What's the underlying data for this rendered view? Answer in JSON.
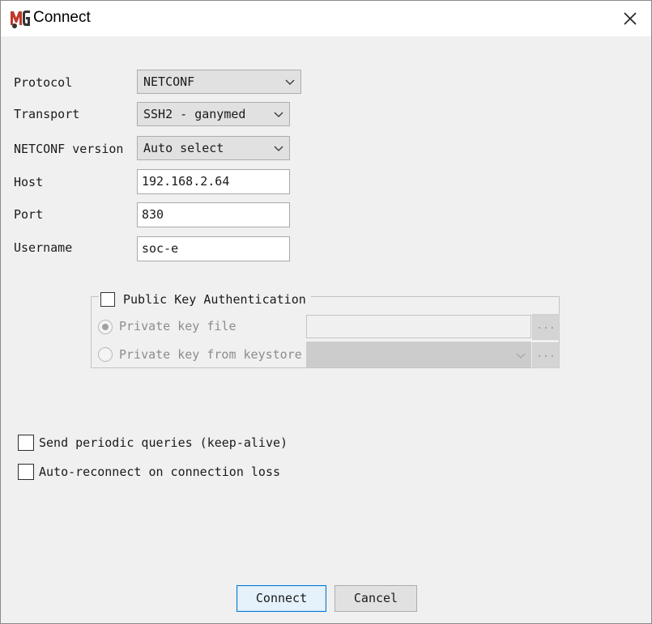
{
  "window": {
    "title": "Connect"
  },
  "form": {
    "protocol": {
      "label": "Protocol",
      "value": "NETCONF"
    },
    "transport": {
      "label": "Transport",
      "value": "SSH2 - ganymed"
    },
    "netconf_version": {
      "label": "NETCONF version",
      "value": "Auto select"
    },
    "host": {
      "label": "Host",
      "value": "192.168.2.64"
    },
    "port": {
      "label": "Port",
      "value": "830"
    },
    "username": {
      "label": "Username",
      "value": "soc-e"
    }
  },
  "pubkey": {
    "label": "Public Key Authentication",
    "checked": false,
    "private_key_file_label": "Private key file",
    "private_key_keystore_label": "Private key from keystore",
    "browse_label": "..."
  },
  "options": {
    "keepalive_label": "Send periodic queries (keep-alive)",
    "reconnect_label": "Auto-reconnect on connection loss"
  },
  "buttons": {
    "connect": "Connect",
    "cancel": "Cancel"
  },
  "colors": {
    "focus_border": "#0078d7",
    "background": "#f0f0f0"
  }
}
